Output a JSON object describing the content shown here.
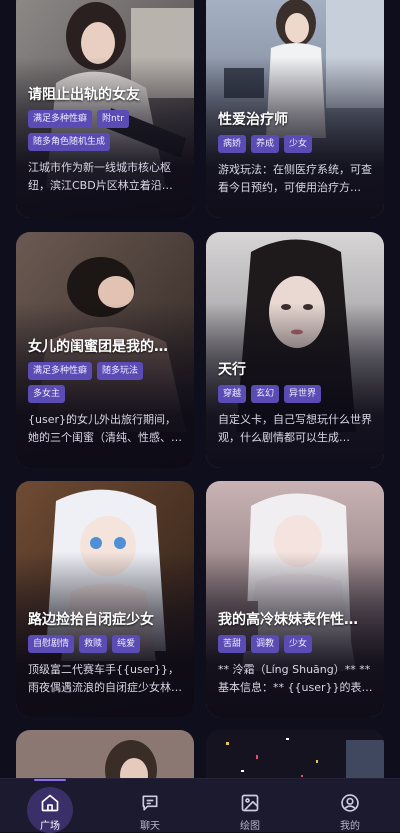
{
  "cards": [
    {
      "title": "请阻止出轨的女友",
      "tags": [
        "满足多种性癖",
        "附ntr",
        "随多角色随机生成"
      ],
      "desc": "江城市作为新一线城市核心枢纽，滨江CBD片区林立着沿…"
    },
    {
      "title": "性爱治疗师",
      "tags": [
        "病娇",
        "养成",
        "少女"
      ],
      "desc": "游戏玩法：在侧医疗系统，可查看今日预约，可使用治疗方…"
    },
    {
      "title": "女儿的闺蜜团是我的…",
      "tags": [
        "满足多种性癖",
        "随多玩法",
        "多女主"
      ],
      "desc": "{user}的女儿外出旅行期间，她的三个闺蜜（清纯、性感、…"
    },
    {
      "title": "天行",
      "tags": [
        "穿越",
        "玄幻",
        "异世界"
      ],
      "desc": "自定义卡，自己写想玩什么世界观，什么剧情都可以生成…"
    },
    {
      "title": "路边捡拾自闭症少女",
      "tags": [
        "自慰剧情",
        "救赎",
        "纯爱"
      ],
      "desc": "顶级富二代赛车手{{user}}，雨夜偶遇流浪的自闭症少女林晚…"
    },
    {
      "title": "我的高冷妹妹表作性…",
      "tags": [
        "苦甜",
        "调教",
        "少女"
      ],
      "desc": "** 泠霜（Líng Shuāng）** ** 基本信息：** {{user}}的表妹…"
    },
    {
      "title": "",
      "tags": [],
      "desc": ""
    },
    {
      "title": "",
      "tags": [],
      "desc": ""
    }
  ],
  "tabbar": {
    "items": [
      {
        "label": "广场",
        "icon": "home-icon",
        "active": true
      },
      {
        "label": "聊天",
        "icon": "chat-icon",
        "active": false
      },
      {
        "label": "绘图",
        "icon": "image-icon",
        "active": false
      },
      {
        "label": "我的",
        "icon": "user-icon",
        "active": false
      }
    ]
  },
  "colors": {
    "background": "#0f0e1c",
    "tag": "#5a4bb5",
    "accent": "#8d6cf0",
    "tabbar": "#1c1a2e"
  }
}
